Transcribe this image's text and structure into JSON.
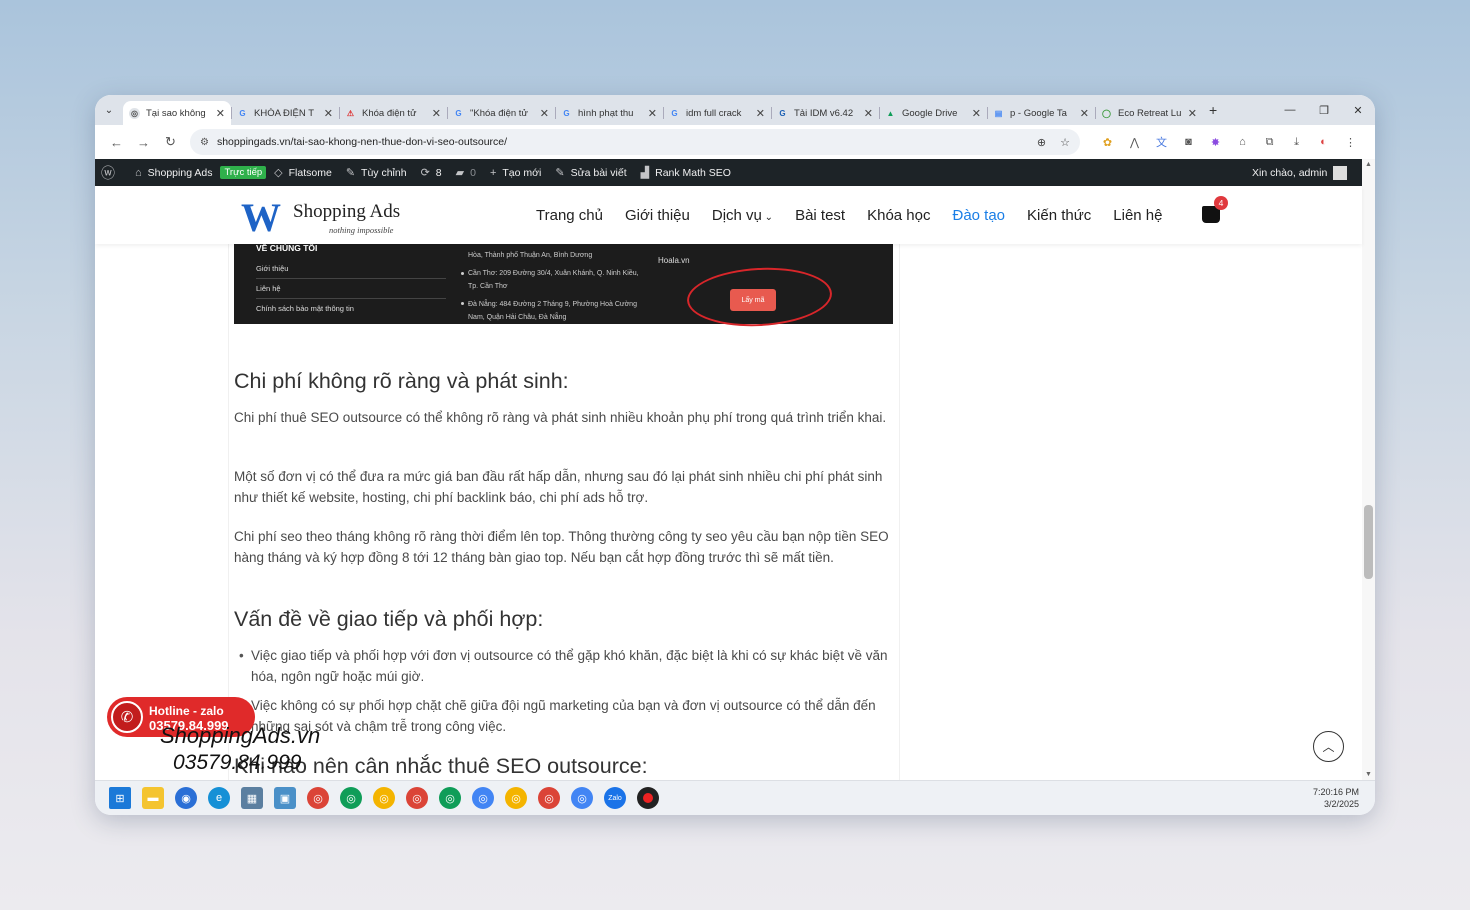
{
  "browser": {
    "tabs": [
      {
        "title": "Tại sao không",
        "icon": "chrome-favicon",
        "active": true
      },
      {
        "title": "KHÓA ĐIỆN T",
        "icon": "google-favicon"
      },
      {
        "title": "Khóa điện tử",
        "icon": "site-favicon"
      },
      {
        "title": "\"Khóa điện tử",
        "icon": "google-favicon"
      },
      {
        "title": "hình phạt thu",
        "icon": "google-favicon"
      },
      {
        "title": "idm full crack",
        "icon": "google-favicon"
      },
      {
        "title": "Tải IDM v6.42",
        "icon": "site-favicon"
      },
      {
        "title": "Google Drive",
        "icon": "drive-favicon"
      },
      {
        "title": "p - Google Ta",
        "icon": "tables-favicon"
      },
      {
        "title": "Eco Retreat Lu",
        "icon": "site-favicon"
      }
    ],
    "url": "shoppingads.vn/tai-sao-khong-nen-thue-don-vi-seo-outsource/"
  },
  "wpbar": {
    "site": "Shopping Ads",
    "live": "Trực tiếp",
    "theme": "Flatsome",
    "customize": "Tùy chỉnh",
    "updates": "8",
    "comments": "0",
    "new": "Tạo mới",
    "edit": "Sửa bài viết",
    "rankmath": "Rank Math SEO",
    "greeting": "Xin chào, admin"
  },
  "site": {
    "logo_name": "Shopping Ads",
    "logo_tagline": "nothing impossible",
    "menu": [
      "Trang chủ",
      "Giới thiệu",
      "Dịch vụ",
      "Bài test",
      "Khóa học",
      "Đào tạo",
      "Kiến thức",
      "Liên hệ"
    ],
    "cart_count": "4"
  },
  "screenshot": {
    "heading": "VỀ CHÚNG TÔI",
    "links": [
      "Giới thiệu",
      "Liên hệ",
      "Chính sách bảo mật thông tin"
    ],
    "addr1a": "Hòa, Thành phố Thuận An, Bình Dương",
    "addr2a": "Cần Thơ: 209 Đường 30/4, Xuân Khánh, Q. Ninh Kiều,",
    "addr2b": "Tp. Cần Thơ",
    "addr3a": "Đà Nẵng: 484 Đường 2 Tháng 9, Phường Hoà Cường",
    "addr3b": "Nam, Quận Hải Châu, Đà Nẵng",
    "domain": "Hoala.vn",
    "button": "Lấy mã"
  },
  "article": {
    "h2_1": "Chi phí không rõ ràng và phát sinh:",
    "p1": "Chi phí thuê SEO outsource có thể không rõ ràng và phát sinh nhiều khoản phụ phí trong quá trình triển khai.",
    "p2": "Một số đơn vị có thể đưa ra mức giá ban đầu rất hấp dẫn, nhưng sau đó lại phát sinh nhiều chi phí phát sinh như thiết kế website, hosting, chi phí backlink báo, chi phí ads hỗ trợ.",
    "p3": "Chi phí seo theo tháng không rõ ràng thời điểm lên top. Thông thường công ty seo yêu cầu bạn nộp tiền SEO hàng tháng và ký hợp đồng 8 tới 12 tháng bàn giao top. Nếu bạn cắt hợp đồng trước thì sẽ mất tiền.",
    "h2_2": "Vấn đề về giao tiếp và phối hợp:",
    "li1": "Việc giao tiếp và phối hợp với đơn vị outsource có thể gặp khó khăn, đặc biệt là khi có sự khác biệt về văn hóa, ngôn ngữ hoặc múi giờ.",
    "li2": "Việc không có sự phối hợp chặt chẽ giữa đội ngũ marketing của bạn và đơn vị outsource có thể dẫn đến những sai sót và chậm trễ trong công việc.",
    "h2_3": "Khi nào nên cân nhắc thuê SEO outsource:"
  },
  "hotline": {
    "label": "Hotline - zalo",
    "number": "03579.84.999"
  },
  "watermark": {
    "line1": "ShoppingAds.vn",
    "line2": "03579.84.999"
  },
  "clock": {
    "time": "7:20:16 PM",
    "date": "3/2/2025"
  },
  "colors": {
    "accent": "#1a7ee6",
    "hotline": "#e02a2a",
    "wpbar": "#1d2327"
  }
}
